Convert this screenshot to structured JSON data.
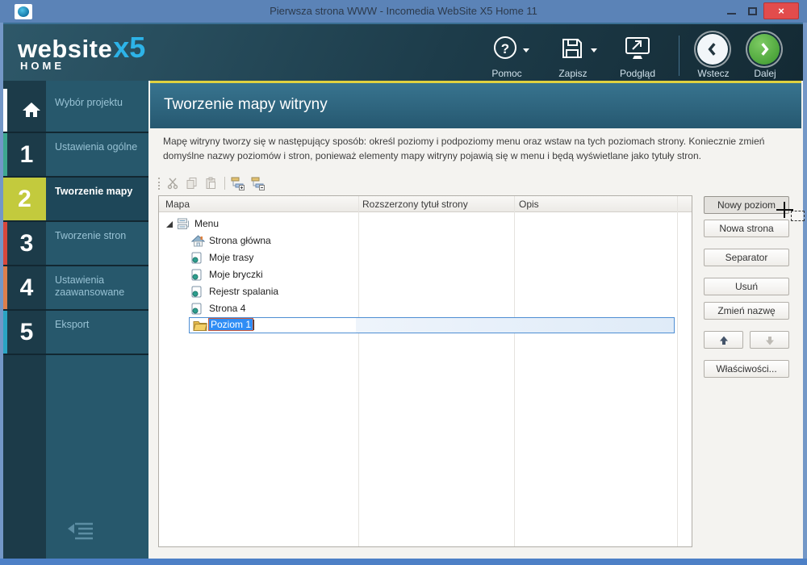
{
  "titlebar": {
    "title": "Pierwsza strona WWW - Incomedia WebSite X5 Home 11",
    "close_glyph": "×"
  },
  "logo": {
    "brand": "website",
    "x5": "x5",
    "edition": "HOME"
  },
  "toolbar": {
    "items": [
      {
        "label": "Pomoc",
        "icon": "help-icon",
        "glyph": "?",
        "dropdown": true
      },
      {
        "label": "Zapisz",
        "icon": "save-icon",
        "dropdown": true
      },
      {
        "label": "Podgląd",
        "icon": "preview-icon",
        "dropdown": false
      },
      {
        "label": "Wstecz",
        "icon": "back-icon",
        "dropdown": false
      },
      {
        "label": "Dalej",
        "icon": "next-icon",
        "dropdown": false
      }
    ]
  },
  "sidebar": {
    "steps": [
      {
        "number": "",
        "label": "Wybór projektu",
        "icon": "home-icon",
        "strip": "#ffffff",
        "active": false
      },
      {
        "number": "1",
        "label": "Ustawienia ogólne",
        "strip": "#3da78f",
        "active": false
      },
      {
        "number": "2",
        "label": "Tworzenie mapy",
        "strip": "#c3ca3d",
        "active": true
      },
      {
        "number": "3",
        "label": "Tworzenie stron",
        "strip": "#d8473c",
        "active": false
      },
      {
        "number": "4",
        "label": "Ustawienia zaawansowane",
        "strip": "#dd7f4c",
        "active": false
      },
      {
        "number": "5",
        "label": "Eksport",
        "strip": "#2aa4c3",
        "active": false
      }
    ],
    "collapse_icon": "collapse-sidebar-icon"
  },
  "page": {
    "title": "Tworzenie mapy witryny",
    "description": "Mapę witryny tworzy się w następujący sposób: określ poziomy i podpoziomy menu oraz wstaw na tych poziomach strony. Koniecznie zmień domyślne nazwy poziomów i stron, ponieważ elementy mapy witryny pojawią się w menu i będą wyświetlane jako tytuły stron."
  },
  "mini_toolbar": {
    "icons": [
      "cut-icon",
      "copy-icon",
      "paste-icon",
      "expand-all-icon",
      "collapse-all-icon"
    ]
  },
  "sitemap": {
    "columns": [
      "Mapa",
      "Rozszerzony tytuł strony",
      "Opis"
    ],
    "rows": [
      {
        "label": "Menu",
        "icon": "sitemap-icon",
        "level": 0,
        "expanded": true
      },
      {
        "label": "Strona główna",
        "icon": "homepage-icon",
        "level": 1
      },
      {
        "label": "Moje trasy",
        "icon": "page-icon",
        "level": 1
      },
      {
        "label": "Moje bryczki",
        "icon": "page-icon",
        "level": 1
      },
      {
        "label": "Rejestr spalania",
        "icon": "page-icon",
        "level": 1
      },
      {
        "label": "Strona 4",
        "icon": "page-icon",
        "level": 1
      },
      {
        "label": "Poziom 1",
        "icon": "folder-icon",
        "level": 1,
        "editing": true
      }
    ]
  },
  "actions": {
    "buttons": [
      "Nowy poziom",
      "Nowa strona",
      "Separator",
      "Usuń",
      "Zmień nazwę",
      "Właściwości..."
    ],
    "move_up_icon": "up-arrow-icon",
    "move_down_icon": "down-arrow-icon"
  },
  "cursor": {
    "style": "crosshair-with-drag-box"
  },
  "colors": {
    "titlebar": "#5b83b7",
    "accent_yellow": "#c3ca3d",
    "band_teal": "#33708d",
    "selection_blue": "#2f8df5",
    "next_green": "#62b94e",
    "close_red": "#e24c4c"
  }
}
